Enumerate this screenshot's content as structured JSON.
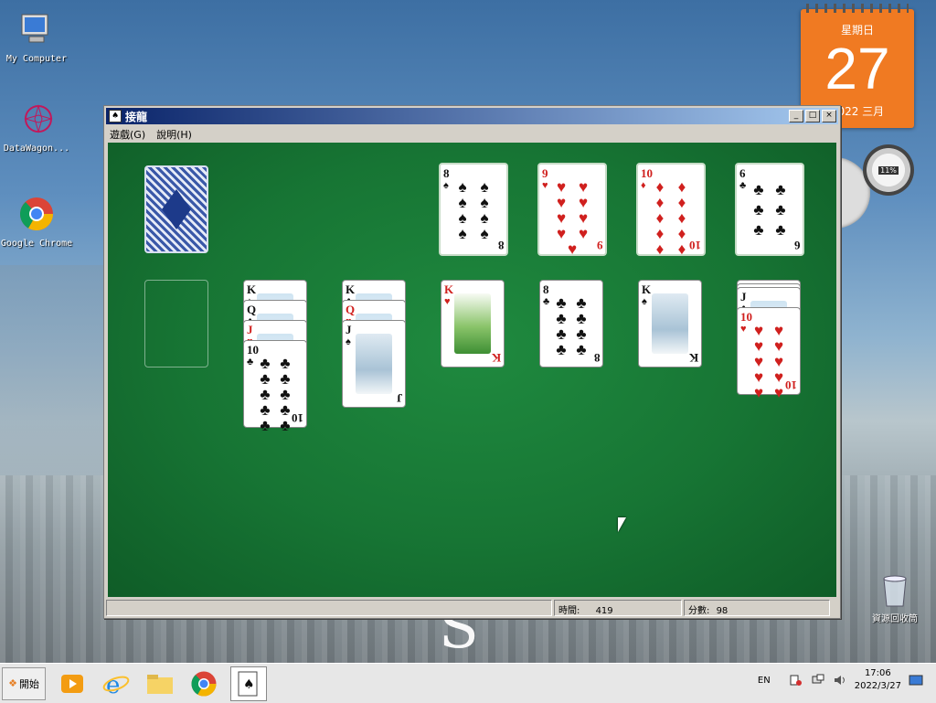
{
  "desktop": {
    "icons": [
      {
        "label": "My Computer"
      },
      {
        "label": "DataWagon..."
      },
      {
        "label": "Google Chrome"
      }
    ],
    "recycle_label": "資源回收筒",
    "watermark_letter": "S"
  },
  "calendar": {
    "day_of_week": "星期日",
    "day": "27",
    "year_month": "2022 三月"
  },
  "gauge": {
    "value": "11%"
  },
  "window": {
    "title": "接龍",
    "menu": [
      "遊戲(G)",
      "說明(H)"
    ],
    "status": {
      "time_label": "時間:",
      "time_value": "419",
      "score_label": "分數:",
      "score_value": "98"
    }
  },
  "cards": {
    "foundations": [
      {
        "rank": "8",
        "suit": "♠",
        "color": "black",
        "pips": 8
      },
      {
        "rank": "9",
        "suit": "♥",
        "color": "red",
        "pips": 9
      },
      {
        "rank": "10",
        "suit": "♦",
        "color": "red",
        "pips": 10
      },
      {
        "rank": "6",
        "suit": "♣",
        "color": "black",
        "pips": 6
      }
    ],
    "tableau": [
      {
        "index": 1,
        "cards": []
      },
      {
        "index": 2,
        "cards": [
          {
            "rank": "K",
            "suit": "♠",
            "color": "black",
            "face": true
          },
          {
            "rank": "Q",
            "suit": "♣",
            "color": "black",
            "face": true
          },
          {
            "rank": "J",
            "suit": "♥",
            "color": "red",
            "face": true
          },
          {
            "rank": "10",
            "suit": "♣",
            "color": "black",
            "pips": 10
          }
        ]
      },
      {
        "index": 3,
        "cards": [
          {
            "rank": "K",
            "suit": "♣",
            "color": "black",
            "face": true
          },
          {
            "rank": "Q",
            "suit": "♥",
            "color": "red",
            "face": true
          },
          {
            "rank": "J",
            "suit": "♠",
            "color": "black",
            "face": true,
            "art": "winter"
          }
        ]
      },
      {
        "index": 4,
        "cards": [
          {
            "rank": "K",
            "suit": "♥",
            "color": "red",
            "face": true,
            "art": "summer"
          }
        ]
      },
      {
        "index": 5,
        "cards": [
          {
            "rank": "8",
            "suit": "♣",
            "color": "black",
            "pips": 8
          }
        ]
      },
      {
        "index": 6,
        "cards": [
          {
            "rank": "K",
            "suit": "♠",
            "color": "black",
            "face": true,
            "art": "winter"
          }
        ]
      },
      {
        "index": 7,
        "cards": [
          {
            "rank": "",
            "suit": "",
            "color": "black",
            "face": true,
            "hidden": true
          },
          {
            "rank": "",
            "suit": "",
            "color": "black",
            "face": true,
            "hidden": true
          },
          {
            "rank": "J",
            "suit": "♣",
            "color": "black",
            "face": true
          },
          {
            "rank": "10",
            "suit": "♥",
            "color": "red",
            "pips": 10
          }
        ]
      }
    ]
  },
  "taskbar": {
    "start_label": "開始",
    "apps": [
      "media-player",
      "internet-explorer",
      "file-explorer",
      "chrome",
      "solitaire"
    ],
    "tray_lang": "EN",
    "clock_time": "17:06",
    "clock_date": "2022/3/27"
  }
}
